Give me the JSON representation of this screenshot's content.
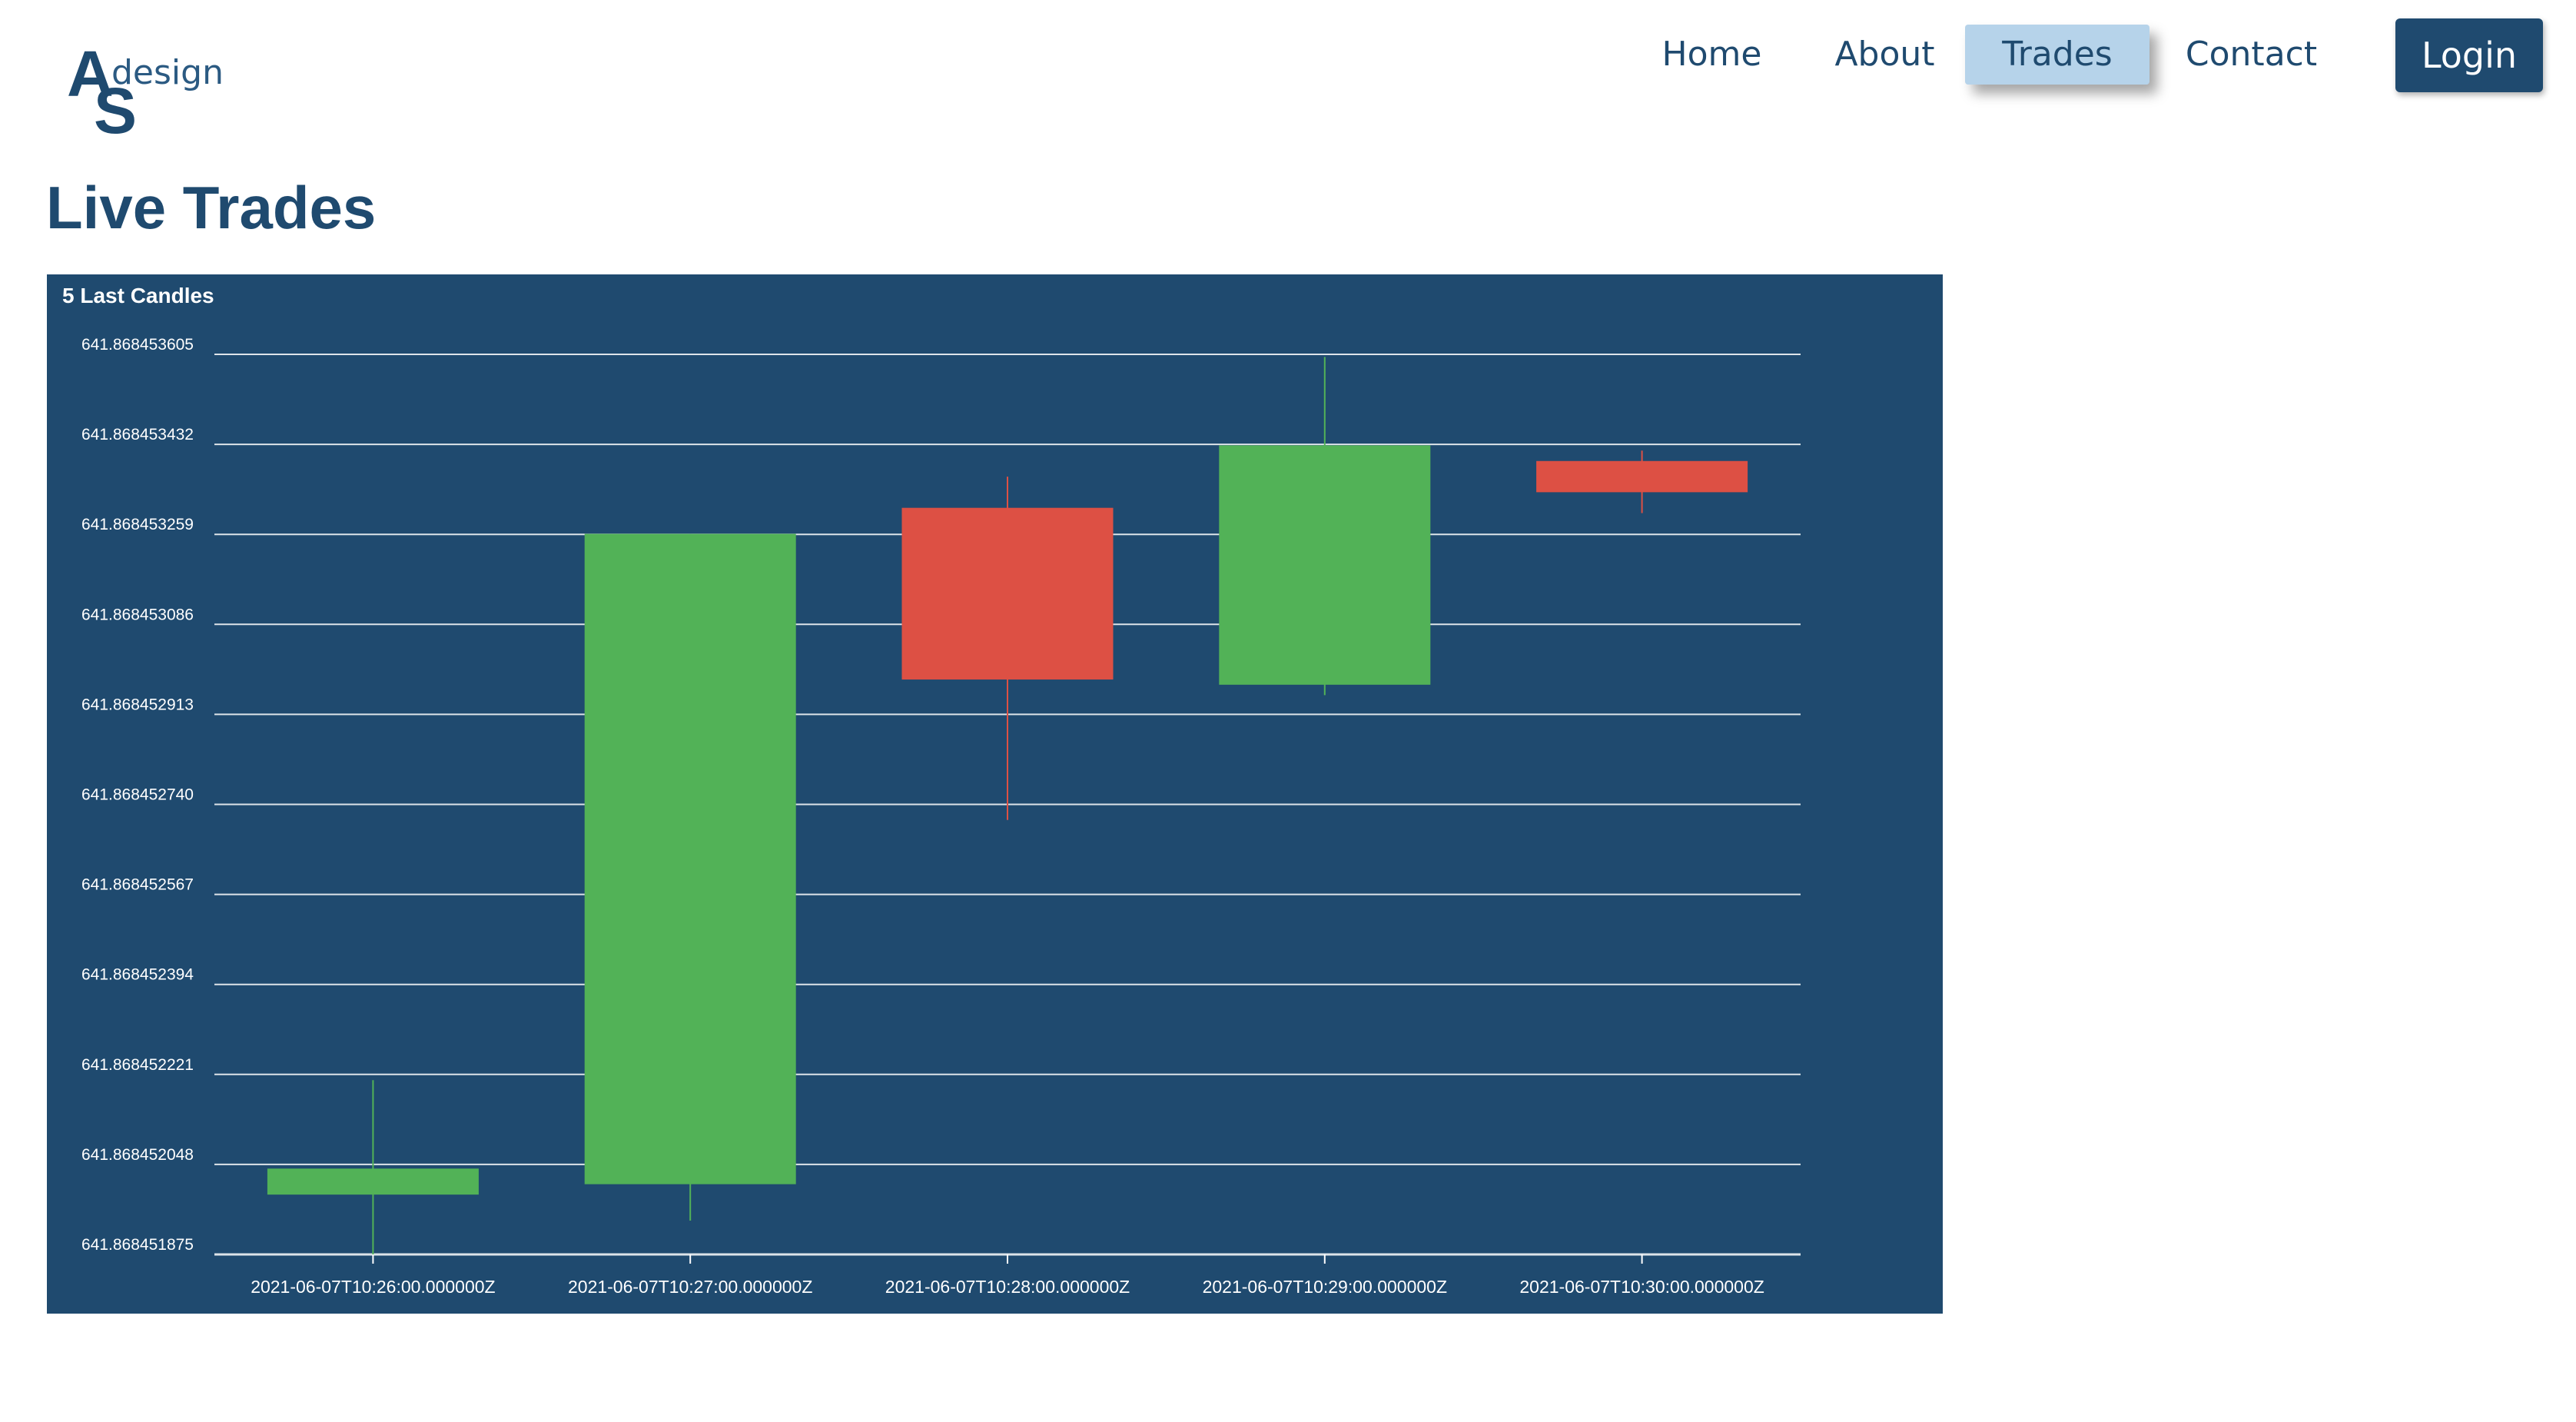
{
  "logo": {
    "letter_a": "A",
    "letter_s": "S",
    "word": "design"
  },
  "nav": {
    "home": "Home",
    "about": "About",
    "trades": "Trades",
    "contact": "Contact",
    "login": "Login",
    "active": "Trades"
  },
  "page_title": "Live Trades",
  "colors": {
    "brand": "#1f4a6f",
    "active_tab": "#b6d3ea",
    "up": "#52b257",
    "down": "#dd5044",
    "chart_bg": "#1f4a6f",
    "grid": "#ffffff"
  },
  "chart_data": {
    "type": "candlestick",
    "title": "5 Last Candles",
    "xlabel": "",
    "ylabel": "",
    "ylim": [
      641.868451875,
      641.868453605
    ],
    "grid": true,
    "y_ticks": [
      "641.868453605",
      "641.868453432",
      "641.868453259",
      "641.868453086",
      "641.868452913",
      "641.868452740",
      "641.868452567",
      "641.868452394",
      "641.868452221",
      "641.868452048",
      "641.868451875"
    ],
    "categories": [
      "2021-06-07T10:26:00.000000Z",
      "2021-06-07T10:27:00.000000Z",
      "2021-06-07T10:28:00.000000Z",
      "2021-06-07T10:29:00.000000Z",
      "2021-06-07T10:30:00.000000Z"
    ],
    "candles": [
      {
        "open": 641.86845199,
        "close": 641.86845204,
        "high": 641.86845221,
        "low": 641.868451875,
        "direction": "up"
      },
      {
        "open": 641.86845201,
        "close": 641.86845326,
        "high": 641.86845326,
        "low": 641.86845194,
        "direction": "up"
      },
      {
        "open": 641.86845331,
        "close": 641.86845298,
        "high": 641.86845337,
        "low": 641.86845271,
        "direction": "down"
      },
      {
        "open": 641.86845297,
        "close": 641.86845343,
        "high": 641.8684536,
        "low": 641.86845295,
        "direction": "up"
      },
      {
        "open": 641.8684534,
        "close": 641.86845334,
        "high": 641.86845342,
        "low": 641.8684533,
        "direction": "down"
      }
    ]
  }
}
